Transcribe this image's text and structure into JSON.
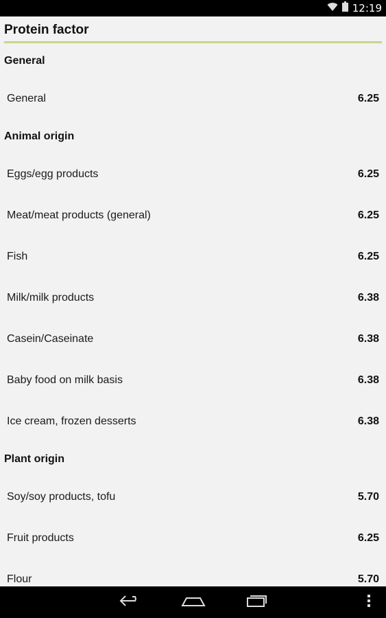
{
  "status_bar": {
    "time": "12:19",
    "icons": [
      "wifi-icon",
      "battery-icon"
    ]
  },
  "header": {
    "title": "Protein factor",
    "accent_color": "#c8d48f"
  },
  "sections": [
    {
      "title": "General",
      "items": [
        {
          "label": "General",
          "value": "6.25"
        }
      ]
    },
    {
      "title": "Animal origin",
      "items": [
        {
          "label": "Eggs/egg products",
          "value": "6.25"
        },
        {
          "label": "Meat/meat products (general)",
          "value": "6.25"
        },
        {
          "label": "Fish",
          "value": "6.25"
        },
        {
          "label": "Milk/milk products",
          "value": "6.38"
        },
        {
          "label": "Casein/Caseinate",
          "value": "6.38"
        },
        {
          "label": "Baby food on milk basis",
          "value": "6.38"
        },
        {
          "label": "Ice cream, frozen desserts",
          "value": "6.38"
        }
      ]
    },
    {
      "title": "Plant origin",
      "items": [
        {
          "label": "Soy/soy products, tofu",
          "value": "5.70"
        },
        {
          "label": "Fruit products",
          "value": "6.25"
        },
        {
          "label": "Flour",
          "value": "5.70"
        }
      ]
    }
  ],
  "nav_bar": {
    "icons": [
      "back-icon",
      "home-icon",
      "recent-apps-icon",
      "overflow-menu-icon"
    ]
  }
}
